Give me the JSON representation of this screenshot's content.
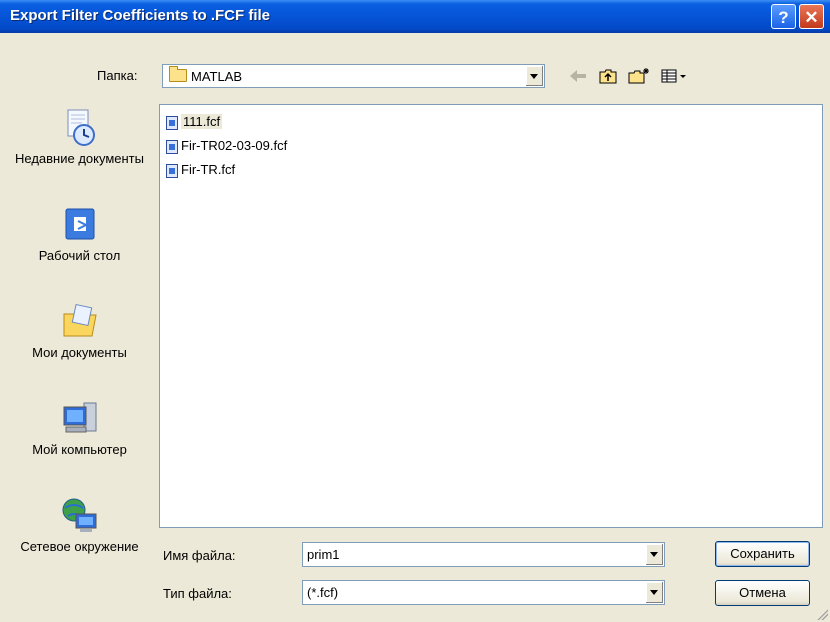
{
  "window": {
    "title": "Export Filter Coefficients to .FCF file",
    "help_label": "?",
    "close_label": "✕"
  },
  "lookin": {
    "label": "Папка:",
    "value": "MATLAB"
  },
  "places": [
    {
      "label": "Недавние документы",
      "icon": "recent-documents-icon"
    },
    {
      "label": "Рабочий стол",
      "icon": "desktop-icon"
    },
    {
      "label": "Мои документы",
      "icon": "my-documents-icon"
    },
    {
      "label": "Мой компьютер",
      "icon": "my-computer-icon"
    },
    {
      "label": "Сетевое окружение",
      "icon": "network-icon"
    }
  ],
  "files": [
    {
      "name": "111.fcf",
      "selected": true
    },
    {
      "name": "Fir-TR02-03-09.fcf",
      "selected": false
    },
    {
      "name": "Fir-TR.fcf",
      "selected": false
    }
  ],
  "filename": {
    "label": "Имя файла:",
    "value": "prim1"
  },
  "filetype": {
    "label": "Тип файла:",
    "value": "(*.fcf)"
  },
  "buttons": {
    "save": "Сохранить",
    "cancel": "Отмена"
  }
}
